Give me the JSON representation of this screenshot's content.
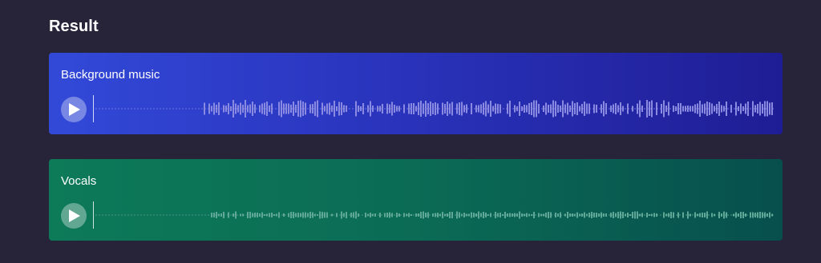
{
  "result": {
    "title": "Result"
  },
  "tracks": [
    {
      "label": "Background music",
      "play_icon": "play-icon",
      "bar_color": "#8a8be0",
      "baseline_color": "#6f74d8",
      "wave_seed": 7,
      "silent_fraction": 0.16
    },
    {
      "label": "Vocals",
      "play_icon": "play-icon",
      "bar_color": "#5fa797",
      "baseline_color": "#4d9486",
      "wave_seed": 13,
      "silent_fraction": 0.17
    }
  ]
}
